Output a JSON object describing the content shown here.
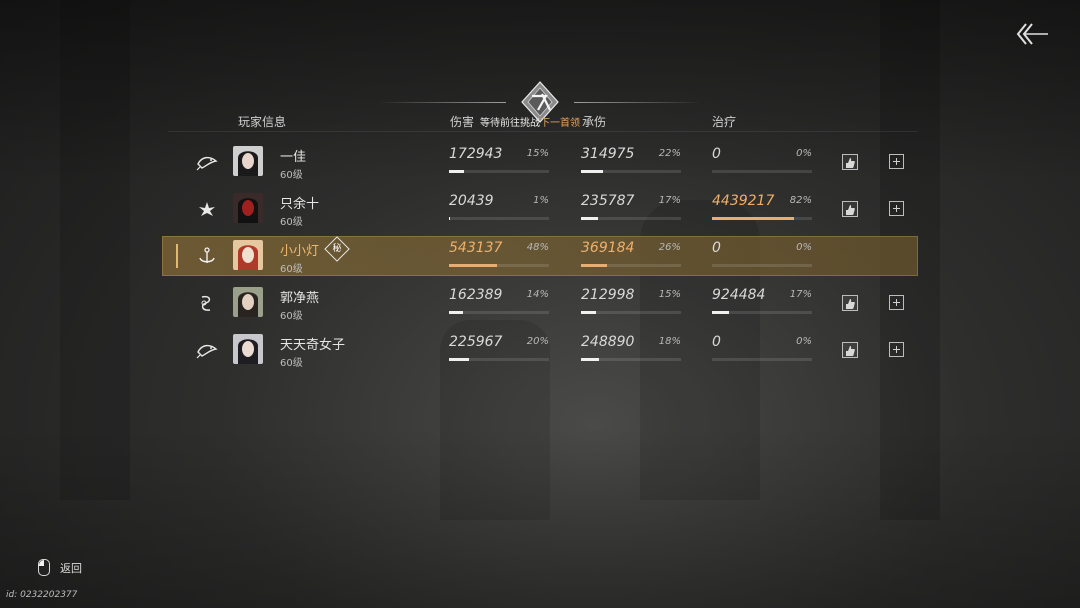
{
  "header": {
    "waiting_prefix": "等待前往挑战",
    "waiting_highlight": "下一首领"
  },
  "columns": {
    "player_info": "玩家信息",
    "damage": "伤害",
    "taken": "承伤",
    "heal": "治疗"
  },
  "players": [
    {
      "name": "一佳",
      "level": "60级",
      "class_icon": "fish-emblem-icon",
      "damage": "172943",
      "damage_pct": "15%",
      "damage_frac": 0.15,
      "taken": "314975",
      "taken_pct": "22%",
      "taken_frac": 0.22,
      "heal": "0",
      "heal_pct": "0%",
      "heal_frac": 0,
      "selected": false
    },
    {
      "name": "只余十",
      "level": "60级",
      "class_icon": "lotus-emblem-icon",
      "damage": "20439",
      "damage_pct": "1%",
      "damage_frac": 0.01,
      "taken": "235787",
      "taken_pct": "17%",
      "taken_frac": 0.17,
      "heal": "4439217",
      "heal_pct": "82%",
      "heal_frac": 0.82,
      "selected": false
    },
    {
      "name": "小小灯",
      "level": "60级",
      "class_icon": "anchor-emblem-icon",
      "badge": "秘",
      "damage": "543137",
      "damage_pct": "48%",
      "damage_frac": 0.48,
      "taken": "369184",
      "taken_pct": "26%",
      "taken_frac": 0.26,
      "heal": "0",
      "heal_pct": "0%",
      "heal_frac": 0,
      "selected": true
    },
    {
      "name": "郭净燕",
      "level": "60级",
      "class_icon": "swirl-emblem-icon",
      "damage": "162389",
      "damage_pct": "14%",
      "damage_frac": 0.14,
      "taken": "212998",
      "taken_pct": "15%",
      "taken_frac": 0.15,
      "heal": "924484",
      "heal_pct": "17%",
      "heal_frac": 0.17,
      "selected": false
    },
    {
      "name": "天天奇女子",
      "level": "60级",
      "class_icon": "fish-emblem-icon",
      "damage": "225967",
      "damage_pct": "20%",
      "damage_frac": 0.2,
      "taken": "248890",
      "taken_pct": "18%",
      "taken_frac": 0.18,
      "heal": "0",
      "heal_pct": "0%",
      "heal_frac": 0,
      "selected": false
    }
  ],
  "footer": {
    "back_label": "返回",
    "uid": "id: 0232202377"
  },
  "colors": {
    "accent": "#f0b06a",
    "selected_row": "#7f6937"
  }
}
